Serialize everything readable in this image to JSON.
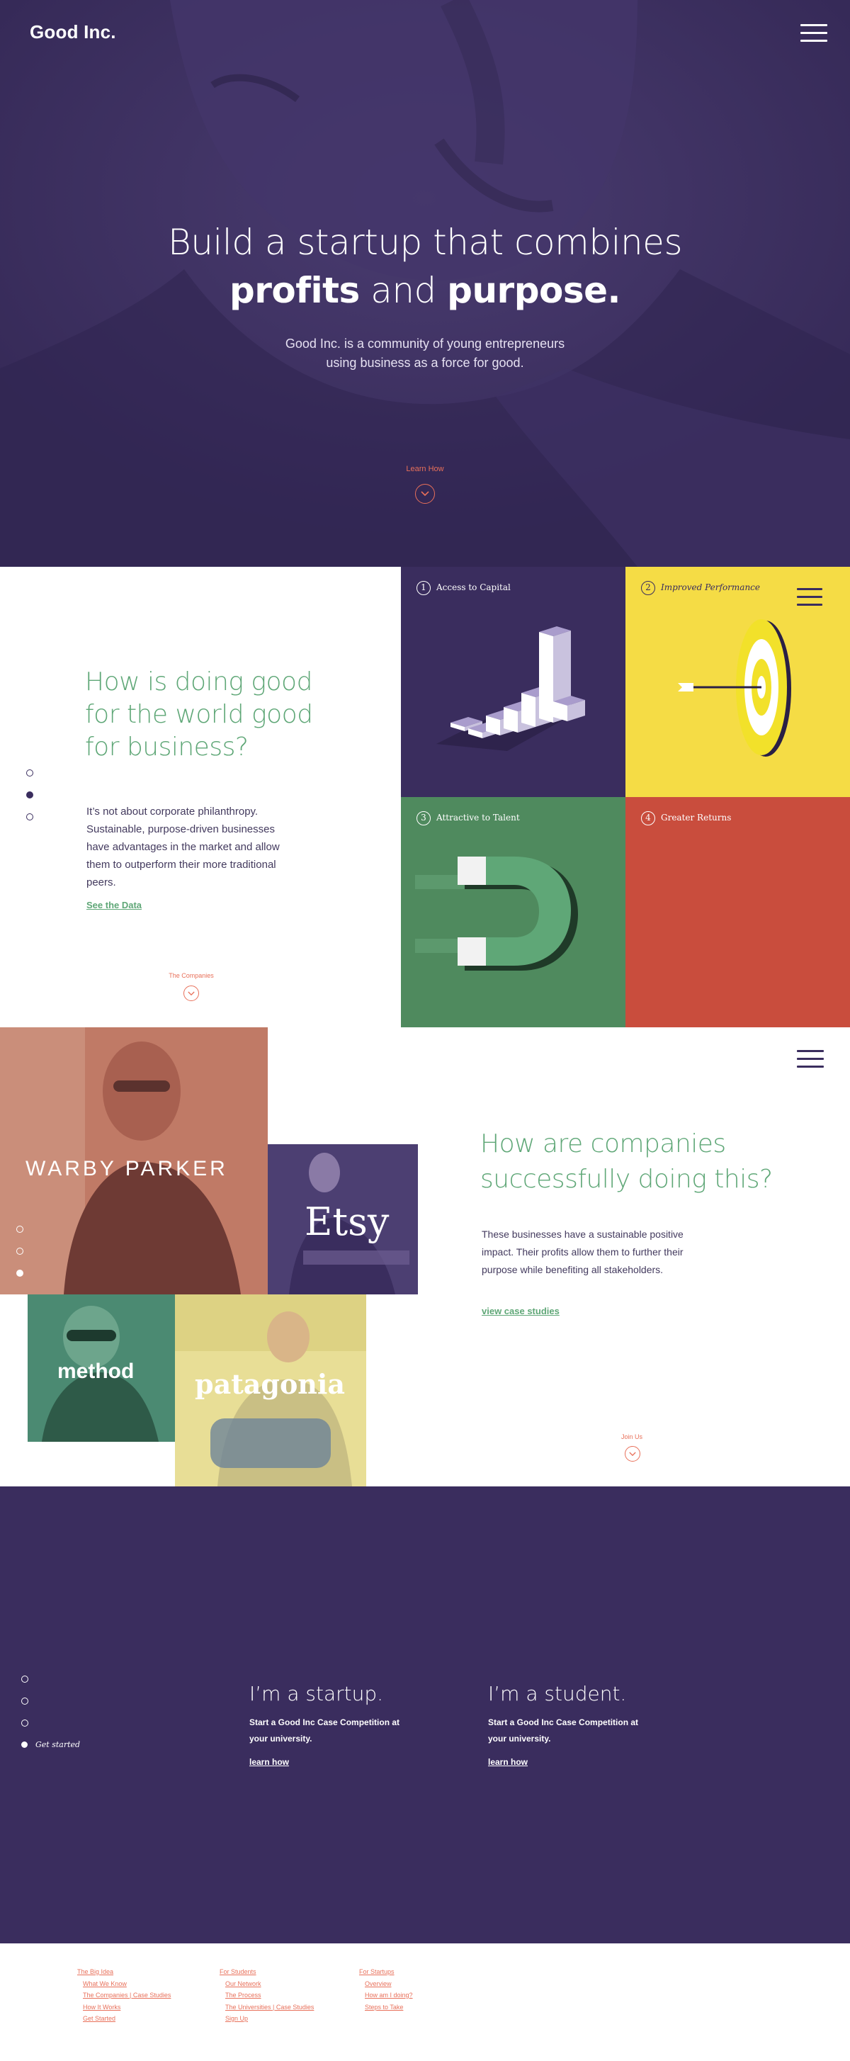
{
  "header": {
    "logo": "Good Inc."
  },
  "hero": {
    "title_line1": "Build a startup that combines",
    "title_bold1": "profits",
    "title_and": " and ",
    "title_bold2": "purpose.",
    "subtitle_line1": "Good Inc. is a community of young entrepreneurs",
    "subtitle_line2": "using business as a force for good.",
    "learn_label": "Learn How"
  },
  "benefits": {
    "title": "How is doing good for the world good for business?",
    "body": "It’s not about corporate philanthropy. Sustainable, purpose-driven businesses have advantages in the market and allow them to outperform their more traditional peers.",
    "link": "See the Data",
    "next_label": "The Companies",
    "tiles": [
      {
        "num": "1",
        "label": "Access to Capital",
        "color": "#3a2d5e"
      },
      {
        "num": "2",
        "label": "Improved Performance",
        "color": "#f5dc45"
      },
      {
        "num": "3",
        "label": "Attractive to Talent",
        "color": "#4f8a5e"
      },
      {
        "num": "4",
        "label": "Greater Returns",
        "color": "#c94d3d"
      }
    ]
  },
  "companies": {
    "brands": [
      "WARBY PARKER",
      "Etsy",
      "method",
      "patagonia"
    ],
    "title": "How are companies successfully doing this?",
    "body": "These businesses have a sustainable positive impact. Their profits allow them to further their purpose while benefiting all stakeholders.",
    "link": "view case studies",
    "next_label": "Join Us"
  },
  "join": {
    "nav_label": "Get started",
    "columns": [
      {
        "title": "I’m a startup.",
        "text": "Start a Good Inc Case Competition at your university.",
        "link": "learn how"
      },
      {
        "title": "I’m a student.",
        "text": "Start a Good Inc Case Competition at your university.",
        "link": "learn how"
      }
    ]
  },
  "footer": {
    "col1": {
      "head": "The Big Idea",
      "items": [
        "What We Know",
        "The Companies  |  Case Studies",
        "How It Works",
        "Get Started"
      ]
    },
    "col2": {
      "head": "For Students",
      "items": [
        "Our Network",
        "The Process",
        "The Universities  |  Case Studies",
        "Sign Up"
      ]
    },
    "col3": {
      "head": "For Startups",
      "items": [
        "Overview",
        "How am I doing?",
        "Steps to Take"
      ]
    }
  },
  "colors": {
    "purple": "#3a2d5e",
    "green": "#5fa777",
    "coral": "#e8705a",
    "yellow": "#f5dc45",
    "red": "#c94d3d"
  }
}
